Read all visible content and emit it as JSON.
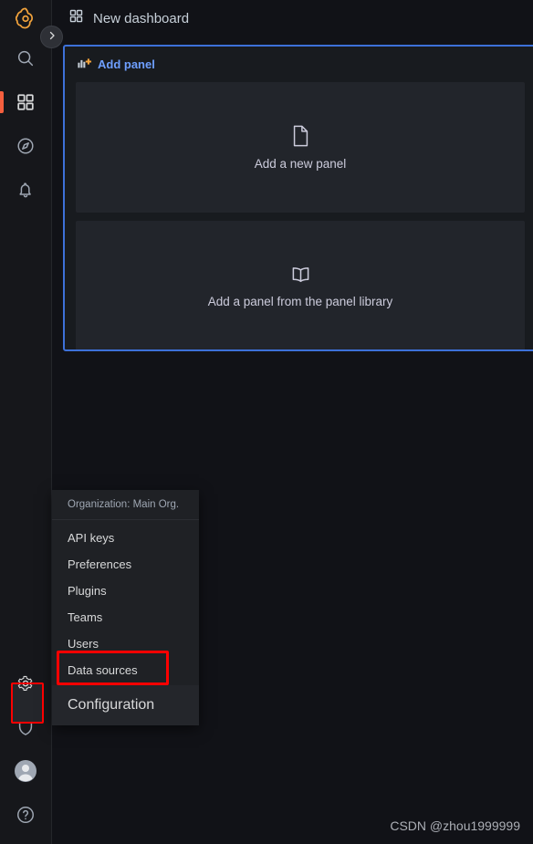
{
  "app": {
    "logo_icon": "grafana-logo-icon"
  },
  "sidebar": {
    "expand_button_icon": "chevron-right-icon",
    "items": [
      {
        "name": "search",
        "icon": "search-icon",
        "active": false
      },
      {
        "name": "dashboards",
        "icon": "dashboards-grid-icon",
        "active": true
      },
      {
        "name": "explore",
        "icon": "compass-icon",
        "active": false
      },
      {
        "name": "alerting",
        "icon": "bell-icon",
        "active": false
      }
    ],
    "bottom_items": [
      {
        "name": "configuration",
        "icon": "gear-icon",
        "active": true
      },
      {
        "name": "server-admin",
        "icon": "shield-icon",
        "active": false
      },
      {
        "name": "user-profile",
        "icon": "avatar-icon",
        "active": false
      },
      {
        "name": "help",
        "icon": "question-circle-icon",
        "active": false
      }
    ]
  },
  "header": {
    "icon": "dashboards-grid-icon",
    "title": "New dashboard"
  },
  "add_panel": {
    "icon": "bar-chart-plus-icon",
    "title": "Add panel",
    "options": [
      {
        "icon": "file-blank-icon",
        "label": "Add a new panel"
      },
      {
        "icon": "book-open-icon",
        "label": "Add a panel from the panel library"
      }
    ]
  },
  "config_menu": {
    "org_label": "Organization: Main Org.",
    "items": [
      {
        "label": "API keys",
        "highlighted": false
      },
      {
        "label": "Preferences",
        "highlighted": false
      },
      {
        "label": "Plugins",
        "highlighted": false
      },
      {
        "label": "Teams",
        "highlighted": false
      },
      {
        "label": "Users",
        "highlighted": false
      },
      {
        "label": "Data sources",
        "highlighted": true
      }
    ],
    "footer_label": "Configuration"
  },
  "annotations": {
    "highlight_color": "#fe0000",
    "accent_color": "#f55f3e",
    "panel_border_color": "#3d71d9",
    "link_color": "#6e9fff"
  },
  "watermark": {
    "text": "CSDN @zhou1999999"
  }
}
